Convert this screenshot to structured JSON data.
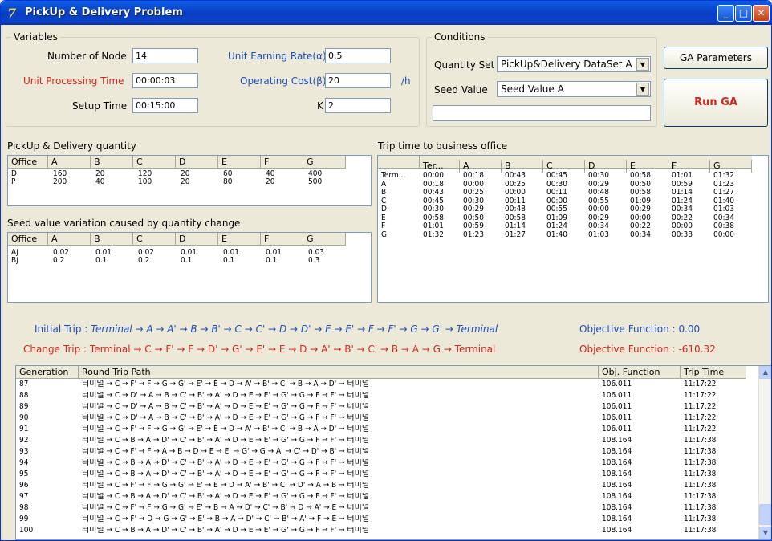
{
  "window": {
    "title": "PickUp & Delivery Problem",
    "icon": "app-logo-icon"
  },
  "variables": {
    "group_title": "Variables",
    "number_of_node_label": "Number of Node",
    "number_of_node": "14",
    "unit_processing_time_label": "Unit Processing Time",
    "unit_processing_time": "00:00:03",
    "setup_time_label": "Setup Time",
    "setup_time": "00:15:00",
    "unit_earning_rate_label": "Unit Earning Rate(α)",
    "unit_earning_rate": "0.5",
    "operating_cost_label": "Operating Cost(β)",
    "operating_cost": "20",
    "operating_cost_unit": "/h",
    "k_label": "K",
    "k": "2"
  },
  "conditions": {
    "group_title": "Conditions",
    "quantity_set_label": "Quantity Set",
    "quantity_set": "PickUp&Delivery DataSet A",
    "seed_value_label": "Seed Value",
    "seed_value": "Seed Value A",
    "extra_field": ""
  },
  "buttons": {
    "ga_parameters": "GA Parameters",
    "run_ga": "Run GA"
  },
  "pd_quantity": {
    "title": "PickUp & Delivery quantity",
    "headers": [
      "Office",
      "A",
      "B",
      "C",
      "D",
      "E",
      "F",
      "G"
    ],
    "rows": [
      [
        "D",
        "160",
        "20",
        "120",
        "20",
        "60",
        "40",
        "400"
      ],
      [
        "P",
        "200",
        "40",
        "100",
        "20",
        "80",
        "20",
        "500"
      ]
    ]
  },
  "seed_variation": {
    "title": "Seed value variation caused by quantity change",
    "headers": [
      "Office",
      "A",
      "B",
      "C",
      "D",
      "E",
      "F",
      "G"
    ],
    "rows": [
      [
        "Aj",
        "0.02",
        "0.01",
        "0.02",
        "0.01",
        "0.01",
        "0.01",
        "0.03"
      ],
      [
        "Bj",
        "0.2",
        "0.1",
        "0.2",
        "0.1",
        "0.1",
        "0.1",
        "0.3"
      ]
    ]
  },
  "trip_time": {
    "title": "Trip time to business office",
    "headers": [
      "",
      "Ter...",
      "A",
      "B",
      "C",
      "D",
      "E",
      "F",
      "G"
    ],
    "rows": [
      [
        "Term...",
        "00:00",
        "00:18",
        "00:43",
        "00:45",
        "00:30",
        "00:58",
        "01:01",
        "01:32"
      ],
      [
        "A",
        "00:18",
        "00:00",
        "00:25",
        "00:30",
        "00:29",
        "00:50",
        "00:59",
        "01:23"
      ],
      [
        "B",
        "00:43",
        "00:25",
        "00:00",
        "00:11",
        "00:48",
        "00:58",
        "01:14",
        "01:27"
      ],
      [
        "C",
        "00:45",
        "00:30",
        "00:11",
        "00:00",
        "00:55",
        "01:09",
        "01:24",
        "01:40"
      ],
      [
        "D",
        "00:30",
        "00:29",
        "00:48",
        "00:55",
        "00:00",
        "00:29",
        "00:34",
        "01:03"
      ],
      [
        "E",
        "00:58",
        "00:50",
        "00:58",
        "01:09",
        "00:29",
        "00:00",
        "00:22",
        "00:34"
      ],
      [
        "F",
        "01:01",
        "00:59",
        "01:14",
        "01:24",
        "00:34",
        "00:22",
        "00:00",
        "00:38"
      ],
      [
        "G",
        "01:32",
        "01:23",
        "01:27",
        "01:40",
        "01:03",
        "00:34",
        "00:38",
        "00:00"
      ]
    ]
  },
  "trips": {
    "initial_label": "Initial Trip :",
    "initial_path": "Terminal → A → A' → B → B' → C → C' → D → D' → E → E' → F → F' → G → G' → Terminal",
    "initial_obj_label": "Objective Function :",
    "initial_obj": "0.00",
    "change_label": "Change Trip :",
    "change_path": "Terminal → C → F' → F → D' → G' → E' → E → D → A' → B' → C' → B → A → G → Terminal",
    "change_obj_label": "Objective Function :",
    "change_obj": "-610.32"
  },
  "generations": {
    "headers": [
      "Generation",
      "Round Trip Path",
      "Obj. Function",
      "Trip Time"
    ],
    "rows": [
      [
        "87",
        "터미널 → C → F' → F → G → G' → E' → E → D → A' → B' → C' → B → A → D' → 터미널",
        "106.011",
        "11:17:22"
      ],
      [
        "88",
        "터미널 → C → D' → A → B → C' → B' → A' → D → E → E' → G' → G → F → F' → 터미널",
        "106.011",
        "11:17:22"
      ],
      [
        "89",
        "터미널 → C → D' → A → B → C' → B' → A' → D → E → E' → G' → G → F → F' → 터미널",
        "106.011",
        "11:17:22"
      ],
      [
        "90",
        "터미널 → C → D' → A → B → C' → B' → A' → D → E → E' → G' → G → F → F' → 터미널",
        "106.011",
        "11:17:22"
      ],
      [
        "91",
        "터미널 → C → F' → F → G → G' → E' → E → D → A' → B' → C' → B → A → D' → 터미널",
        "106.011",
        "11:17:22"
      ],
      [
        "92",
        "터미널 → C → B → A → D' → C' → B' → A' → D → E → E' → G' → G → F → F' → 터미널",
        "108.164",
        "11:17:38"
      ],
      [
        "93",
        "터미널 → C → F' → F → A → B → D → E → E' → G' → G → A' → C' → D' → B' → 터미널",
        "108.164",
        "11:17:38"
      ],
      [
        "94",
        "터미널 → C → B → A → D' → C' → B' → A' → D → E → E' → G' → G → F → F' → 터미널",
        "108.164",
        "11:17:38"
      ],
      [
        "95",
        "터미널 → C → B → A → D' → C' → B' → A' → D → E → E' → G' → G → F → F' → 터미널",
        "108.164",
        "11:17:38"
      ],
      [
        "96",
        "터미널 → C → F' → F → G → G' → E' → E → D → A' → B' → C' → D' → A → B → 터미널",
        "108.164",
        "11:17:38"
      ],
      [
        "97",
        "터미널 → C → B → A → D' → C' → B' → A' → D → E → E' → G' → G → F → F' → 터미널",
        "108.164",
        "11:17:38"
      ],
      [
        "98",
        "터미널 → C → F' → F → G → G' → E' → B → A → D' → C' → B' → D → A' → E → 터미널",
        "108.164",
        "11:17:38"
      ],
      [
        "99",
        "터미널 → C → F' → D → G → G' → E' → B → A → D' → C' → B' → A' → F → E → 터미널",
        "108.164",
        "11:17:38"
      ],
      [
        "100",
        "터미널 → C → B → A → D' → C' → B' → A' → D → E → E' → G' → G → F → F' → 터미널",
        "108.164",
        "11:17:38"
      ]
    ]
  },
  "colors": {
    "accent_red": "#d2281f",
    "accent_blue": "#1f4fb8",
    "titlebar": "#0a4fd6"
  }
}
